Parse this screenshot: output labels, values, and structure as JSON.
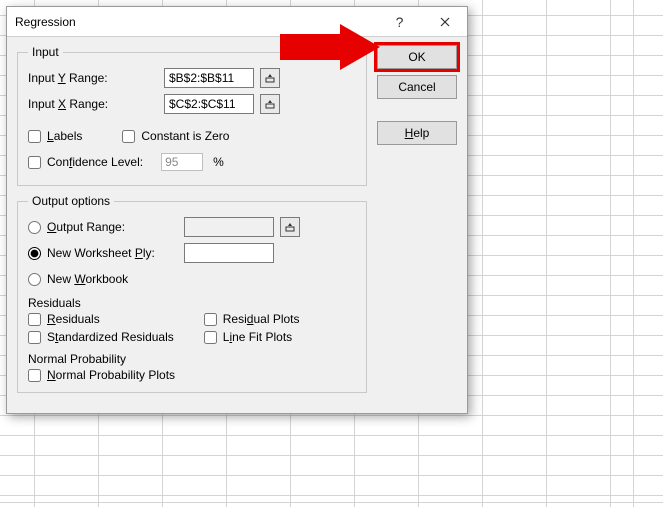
{
  "titlebar": {
    "title": "Regression"
  },
  "buttons": {
    "ok": "OK",
    "cancel": "Cancel",
    "help": "Help"
  },
  "input": {
    "legend": "Input",
    "y_label_pre": "Input ",
    "y_label_u": "Y",
    "y_label_post": " Range:",
    "y_value": "$B$2:$B$11",
    "x_label_pre": "Input ",
    "x_label_u": "X",
    "x_label_post": " Range:",
    "x_value": "$C$2:$C$11",
    "labels_u": "L",
    "labels_post": "abels",
    "constzero": "Constant is Zero",
    "conf_pre": "Con",
    "conf_u": "f",
    "conf_post": "idence Level:",
    "conf_value": "95",
    "pct": "%"
  },
  "output": {
    "legend": "Output options",
    "range_u": "O",
    "range_post": "utput Range:",
    "ply_pre": "New Worksheet ",
    "ply_u": "P",
    "ply_post": "ly:",
    "wb_pre": "New ",
    "wb_u": "W",
    "wb_post": "orkbook",
    "residuals_head": "Residuals",
    "res_u": "R",
    "res_post": "esiduals",
    "stdres_pre": "S",
    "stdres_u": "t",
    "stdres_post": "andardized Residuals",
    "resplot_pre": "Resi",
    "resplot_u": "d",
    "resplot_post": "ual Plots",
    "lineplot_pre": "L",
    "lineplot_u": "i",
    "lineplot_post": "ne Fit Plots",
    "normprob_head": "Normal Probability",
    "normprob_u": "N",
    "normprob_post": "ormal Probability Plots"
  }
}
